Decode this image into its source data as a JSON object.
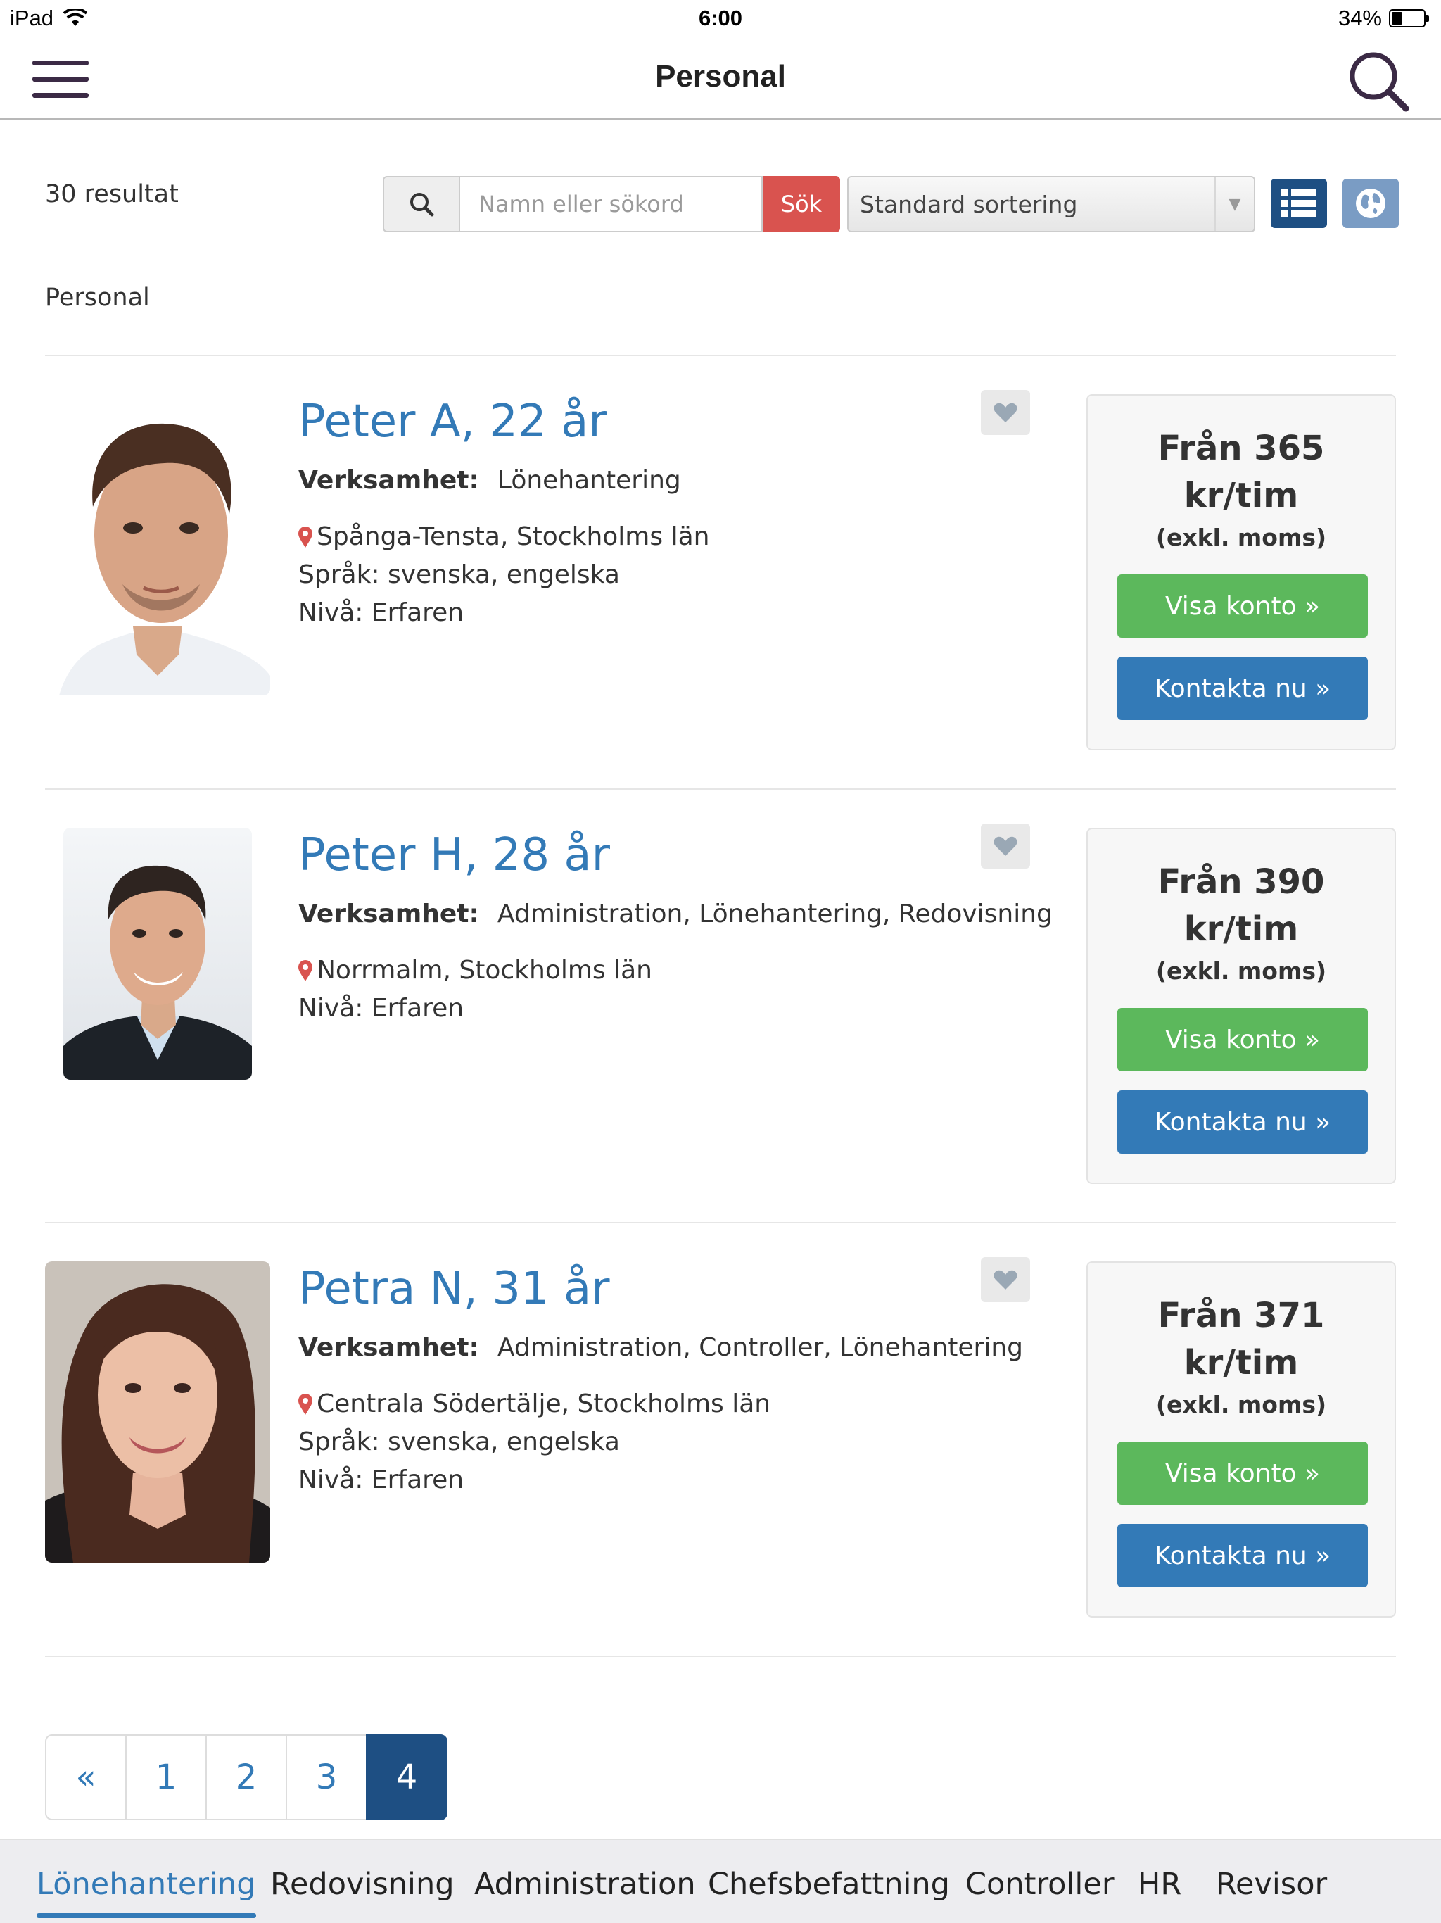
{
  "status_bar": {
    "device": "iPad",
    "time": "6:00",
    "battery": "34%",
    "battery_level": 0.34
  },
  "nav": {
    "title": "Personal"
  },
  "toolbar": {
    "result_count": "30 resultat",
    "search_placeholder": "Namn eller sökord",
    "search_button": "Sök",
    "sort_selected": "Standard sortering"
  },
  "section_label": "Personal",
  "labels": {
    "business": "Verksamhet:"
  },
  "people": [
    {
      "name": "Peter A, 22 år",
      "business": "Lönehantering",
      "location": "Spånga-Tensta, Stockholms län",
      "language": "Språk: svenska, engelska",
      "level": "Nivå: Erfaren",
      "price_line1": "Från 365",
      "price_line2": "kr/tim",
      "price_note": "(exkl. moms)",
      "view_button": "Visa konto »",
      "contact_button": "Kontakta nu »"
    },
    {
      "name": "Peter H, 28 år",
      "business": "Administration, Lönehantering, Redovisning",
      "location": "Norrmalm, Stockholms län",
      "level": "Nivå: Erfaren",
      "price_line1": "Från 390",
      "price_line2": "kr/tim",
      "price_note": "(exkl. moms)",
      "view_button": "Visa konto »",
      "contact_button": "Kontakta nu »"
    },
    {
      "name": "Petra N, 31 år",
      "business": "Administration, Controller, Lönehantering",
      "location": "Centrala Södertälje, Stockholms län",
      "language": "Språk: svenska, engelska",
      "level": "Nivå: Erfaren",
      "price_line1": "Från 371",
      "price_line2": "kr/tim",
      "price_note": "(exkl. moms)",
      "view_button": "Visa konto »",
      "contact_button": "Kontakta nu »"
    }
  ],
  "pagination": {
    "prev": "«",
    "pages": [
      "1",
      "2",
      "3",
      "4"
    ],
    "current": "4"
  },
  "bottom_tabs": [
    "Lönehantering",
    "Redovisning",
    "Administration",
    "Chefsbefattning",
    "Controller",
    "HR",
    "Revisor"
  ],
  "bottom_tab_active": "Lönehantering",
  "colors": {
    "link": "#337ab7",
    "success": "#5cb85c",
    "danger": "#d9534f",
    "active_page": "#1e4f83"
  }
}
